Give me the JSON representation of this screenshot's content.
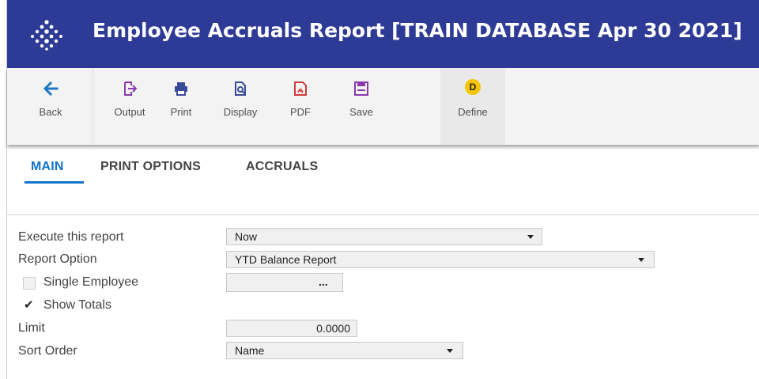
{
  "header": {
    "title": "Employee Accruals Report [TRAIN DATABASE Apr 30 2021]",
    "background": "#2e3b96",
    "logo_icon": "dotted-diamond-logo"
  },
  "toolbar": {
    "buttons": [
      {
        "label": "Back",
        "icon": "arrow-left-icon"
      },
      {
        "label": "Output",
        "icon": "output-icon"
      },
      {
        "label": "Print",
        "icon": "printer-icon"
      },
      {
        "label": "Display",
        "icon": "preview-icon"
      },
      {
        "label": "PDF",
        "icon": "pdf-icon"
      },
      {
        "label": "Save",
        "icon": "save-icon"
      },
      {
        "label": "Define",
        "icon": "define-badge",
        "badge": "D"
      }
    ]
  },
  "tabs": [
    {
      "label": "MAIN",
      "active": true
    },
    {
      "label": "PRINT OPTIONS",
      "active": false
    },
    {
      "label": "ACCRUALS",
      "active": false
    }
  ],
  "form": {
    "execute": {
      "label": "Execute this report",
      "value": "Now"
    },
    "report_option": {
      "label": "Report Option",
      "value": "YTD Balance Report"
    },
    "single_employee": {
      "label": "Single Employee",
      "checked": false,
      "value": "",
      "button": "..."
    },
    "show_totals": {
      "label": "Show Totals",
      "checked": true
    },
    "limit": {
      "label": "Limit",
      "value": "0.0000"
    },
    "sort_order": {
      "label": "Sort Order",
      "value": "Name"
    }
  },
  "colors": {
    "accent": "#1273c9",
    "toolbar_bg": "#f3f3f3",
    "badge": "#f5c400"
  }
}
